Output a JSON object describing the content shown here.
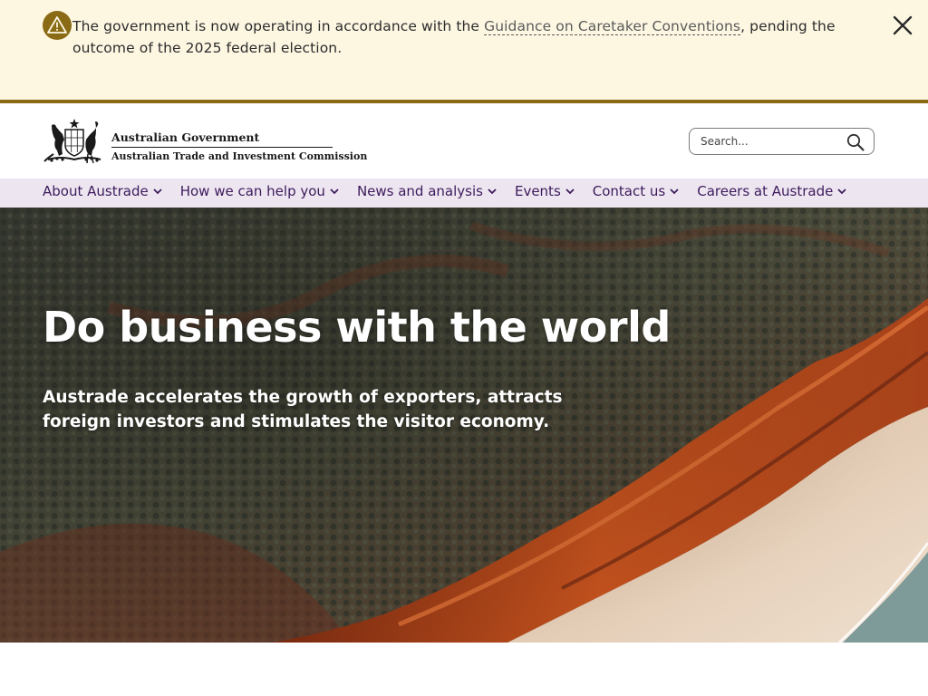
{
  "alert": {
    "text_before": "The government is now operating in accordance with the ",
    "link_text": "Guidance on Caretaker Conventions",
    "text_after": ", pending the outcome of the 2025 federal election.",
    "close_icon": "close-icon",
    "warning_icon": "warning-icon"
  },
  "header": {
    "gov_name": "Australian Government",
    "agency_name": "Australian Trade and Investment Commission",
    "search_placeholder": "Search...",
    "search_icon": "search-icon"
  },
  "nav": {
    "items": [
      {
        "label": "About Austrade"
      },
      {
        "label": "How we can help you"
      },
      {
        "label": "News and analysis"
      },
      {
        "label": "Events"
      },
      {
        "label": "Contact us"
      },
      {
        "label": "Careers at Austrade"
      }
    ]
  },
  "hero": {
    "title": "Do business with the world",
    "subtitle": "Austrade accelerates the growth of exporters, attracts foreign investors and stimulates the visitor economy."
  },
  "colors": {
    "alert_bg": "#fdf7e2",
    "alert_accent": "#8a6a14",
    "nav_bg": "#ede6f0",
    "nav_text": "#3d1a5c"
  }
}
